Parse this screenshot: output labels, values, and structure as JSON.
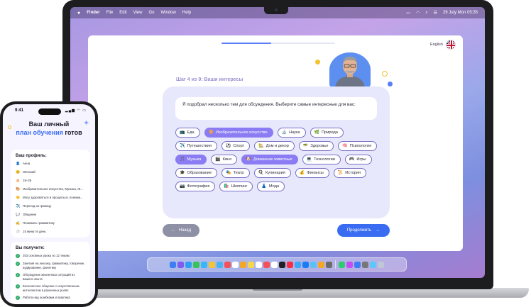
{
  "menubar": {
    "apple": "",
    "app": "Finder",
    "items": [
      "File",
      "Edit",
      "View",
      "Go",
      "Window",
      "Help"
    ],
    "datetime": "29 July Mon 05:35"
  },
  "app": {
    "language": "English",
    "progress_fraction": 0.44,
    "step_label": "Шаг 4 из 9: Ваши интересы",
    "prompt": "Я подобрал несколько тем для обсуждения. Выберите самые интересные для вас:",
    "topics": [
      {
        "icon": "📺",
        "label": "Еда",
        "selected": false
      },
      {
        "icon": "🎨",
        "label": "Изобразительное искусство",
        "selected": true
      },
      {
        "icon": "🔬",
        "label": "Наука",
        "selected": false
      },
      {
        "icon": "🌿",
        "label": "Природа",
        "selected": false
      },
      {
        "icon": "✈️",
        "label": "Путешествия",
        "selected": false
      },
      {
        "icon": "⚽",
        "label": "Спорт",
        "selected": false
      },
      {
        "icon": "🏡",
        "label": "Дом и декор",
        "selected": false
      },
      {
        "icon": "🥗",
        "label": "Здоровье",
        "selected": false
      },
      {
        "icon": "🧠",
        "label": "Психология",
        "selected": false
      },
      {
        "icon": "🎵",
        "label": "Музыка",
        "selected": true
      },
      {
        "icon": "🎬",
        "label": "Кино",
        "selected": false
      },
      {
        "icon": "🐶",
        "label": "Домашние животные",
        "selected": true
      },
      {
        "icon": "💻",
        "label": "Технологии",
        "selected": false
      },
      {
        "icon": "🎮",
        "label": "Игры",
        "selected": false
      },
      {
        "icon": "🎓",
        "label": "Образование",
        "selected": false
      },
      {
        "icon": "🎭",
        "label": "Театр",
        "selected": false
      },
      {
        "icon": "🍳",
        "label": "Кулинария",
        "selected": false
      },
      {
        "icon": "💰",
        "label": "Финансы",
        "selected": false
      },
      {
        "icon": "📜",
        "label": "История",
        "selected": false
      },
      {
        "icon": "📷",
        "label": "Фотография",
        "selected": false
      },
      {
        "icon": "🛍️",
        "label": "Шоппинг",
        "selected": false
      },
      {
        "icon": "👗",
        "label": "Мода",
        "selected": false
      }
    ],
    "back_label": "Назад",
    "next_label": "Продолжить"
  },
  "dock": {
    "colors": [
      "#3d7ef5",
      "#7d5cf0",
      "#2e9ef5",
      "#37c456",
      "#38b7f5",
      "#f5c432",
      "#4ab3f0",
      "#f54f5b",
      "#ffffff",
      "#f5a623",
      "#f7d74a",
      "#ffffff",
      "#f54f5b",
      "#ffffff",
      "#222222",
      "#fa2d48",
      "#3ba7f7",
      "#1c7cf5",
      "#59c2f5",
      "#f5a623",
      "#6b6b6b",
      "#2ecc71",
      "#c44df5",
      "#3d7ef5",
      "#777777",
      "#5ac8fa",
      "#bfc7d4"
    ]
  },
  "phone": {
    "time": "9:41",
    "status": "▂▄▆ ◠ ▭",
    "title_line1": "Ваш личный",
    "title_highlight": "план обучения",
    "title_tail": "готов",
    "profile_title": "Ваш профиль:",
    "profile_items": [
      {
        "icon": "👤",
        "text": "Анна"
      },
      {
        "icon": "😊",
        "text": "Женский"
      },
      {
        "icon": "🎂",
        "text": "18–25"
      },
      {
        "icon": "🎨",
        "text": "Изобразительное искусство, Музыка, Ж..."
      },
      {
        "icon": "👏",
        "text": "Могу здороваться и прощаться, понима..."
      },
      {
        "icon": "✈️",
        "text": "Переезд за границу"
      },
      {
        "icon": "💬",
        "text": "Общение"
      },
      {
        "icon": "✍️",
        "text": "Понимать грамматику"
      },
      {
        "icon": "⏱️",
        "text": "15 минут в день"
      }
    ],
    "benefits_title": "Вы получите:",
    "benefits": [
      "253 основных урока по 12 темам",
      "Занятия на лексику, грамматику, говорение, аудирование, фонетику",
      "Обсуждение жизненных ситуаций из вашего опыта",
      "Бесконечное общение с искусственным интеллектом в различных ролях",
      "Работа над ошибками и практика"
    ]
  }
}
